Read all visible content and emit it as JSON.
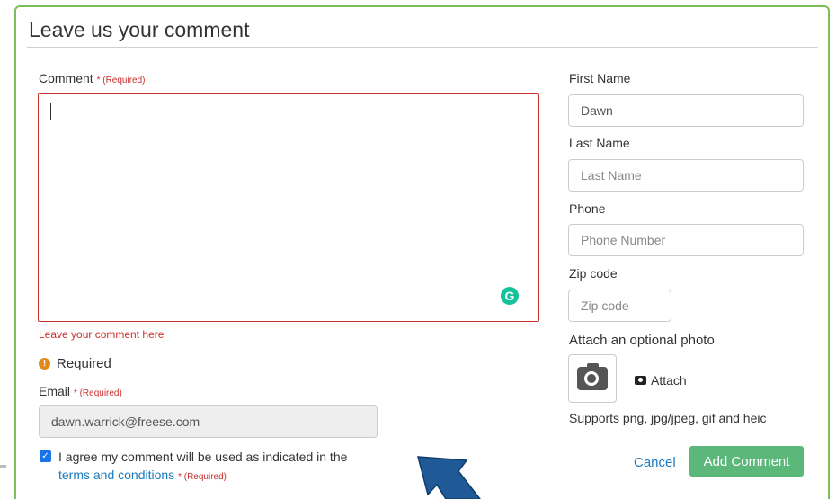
{
  "form": {
    "title": "Leave us your comment",
    "comment": {
      "label": "Comment",
      "required_mark": "* (Required)",
      "value": "",
      "hint": "Leave your comment here"
    },
    "validation": {
      "message": "Required",
      "icon": "info-icon"
    },
    "email": {
      "label": "Email",
      "required_mark": "* (Required)",
      "value": "dawn.warrick@freese.com"
    },
    "agreement": {
      "checked": true,
      "text": "I agree my comment will be used as indicated in the",
      "link_text": "terms and conditions",
      "required_mark": "* (Required)"
    },
    "first_name": {
      "label": "First Name",
      "value": "Dawn",
      "placeholder": ""
    },
    "last_name": {
      "label": "Last Name",
      "value": "",
      "placeholder": "Last Name"
    },
    "phone": {
      "label": "Phone",
      "value": "",
      "placeholder": "Phone Number"
    },
    "zip": {
      "label": "Zip code",
      "value": "",
      "placeholder": "Zip code"
    },
    "photo": {
      "label": "Attach an optional photo",
      "attach_label": "Attach",
      "supports": "Supports png, jpg/jpeg, gif and heic"
    },
    "actions": {
      "cancel": "Cancel",
      "submit": "Add Comment"
    }
  },
  "colors": {
    "panel_border": "#7cbf5a",
    "error": "#c9302c",
    "link": "#1a7bbd",
    "submit": "#5cb87a",
    "grammarly": "#15c39a",
    "arrow": "#1f5a97"
  }
}
